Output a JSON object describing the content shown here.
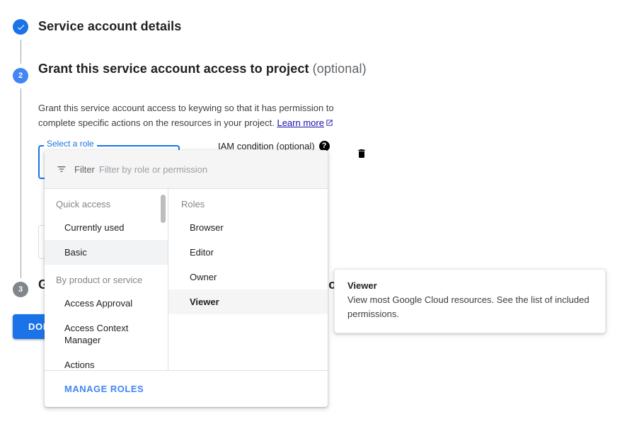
{
  "steps": {
    "step1": {
      "label": "Service account details",
      "state": "done",
      "icon": "check-icon"
    },
    "step2": {
      "number": "2",
      "title": "Grant this service account access to project",
      "optional": "(optional)"
    },
    "step3": {
      "number": "3",
      "title": "Grant users access to this service account (optional)"
    }
  },
  "description": {
    "text": "Grant this service account access to keywing so that it has permission to complete specific actions on the resources in your project.",
    "link_label": "Learn more",
    "link_icon": "external-link-icon"
  },
  "role_field": {
    "floating_label": "Select a role",
    "value": "",
    "placeholder": ""
  },
  "iam_condition": {
    "label": "IAM condition (optional)",
    "help_icon": "help-icon"
  },
  "delete_role": {
    "icon": "trash-icon"
  },
  "done_button": {
    "label": "DONE"
  },
  "dropdown": {
    "filter": {
      "icon": "filter-icon",
      "word": "Filter",
      "placeholder": "Filter by role or permission",
      "value": ""
    },
    "left_column": {
      "group1_label": "Quick access",
      "group1_items": [
        "Currently used",
        "Basic"
      ],
      "selected_item": "Basic",
      "group2_label": "By product or service",
      "group2_items": [
        "Access Approval",
        "Access Context Manager",
        "Actions"
      ]
    },
    "right_column": {
      "label": "Roles",
      "items": [
        "Browser",
        "Editor",
        "Owner",
        "Viewer"
      ],
      "selected_item": "Viewer"
    },
    "footer": {
      "manage_roles_label": "MANAGE ROLES"
    }
  },
  "tooltip": {
    "title": "Viewer",
    "body": "View most Google Cloud resources. See the list of included permissions."
  },
  "colors": {
    "accent_blue": "#1a73e8",
    "step_blue": "#4285f4",
    "link_blue": "#1a0dab",
    "gray_step": "#80868b",
    "muted_text": "#5f6368"
  }
}
